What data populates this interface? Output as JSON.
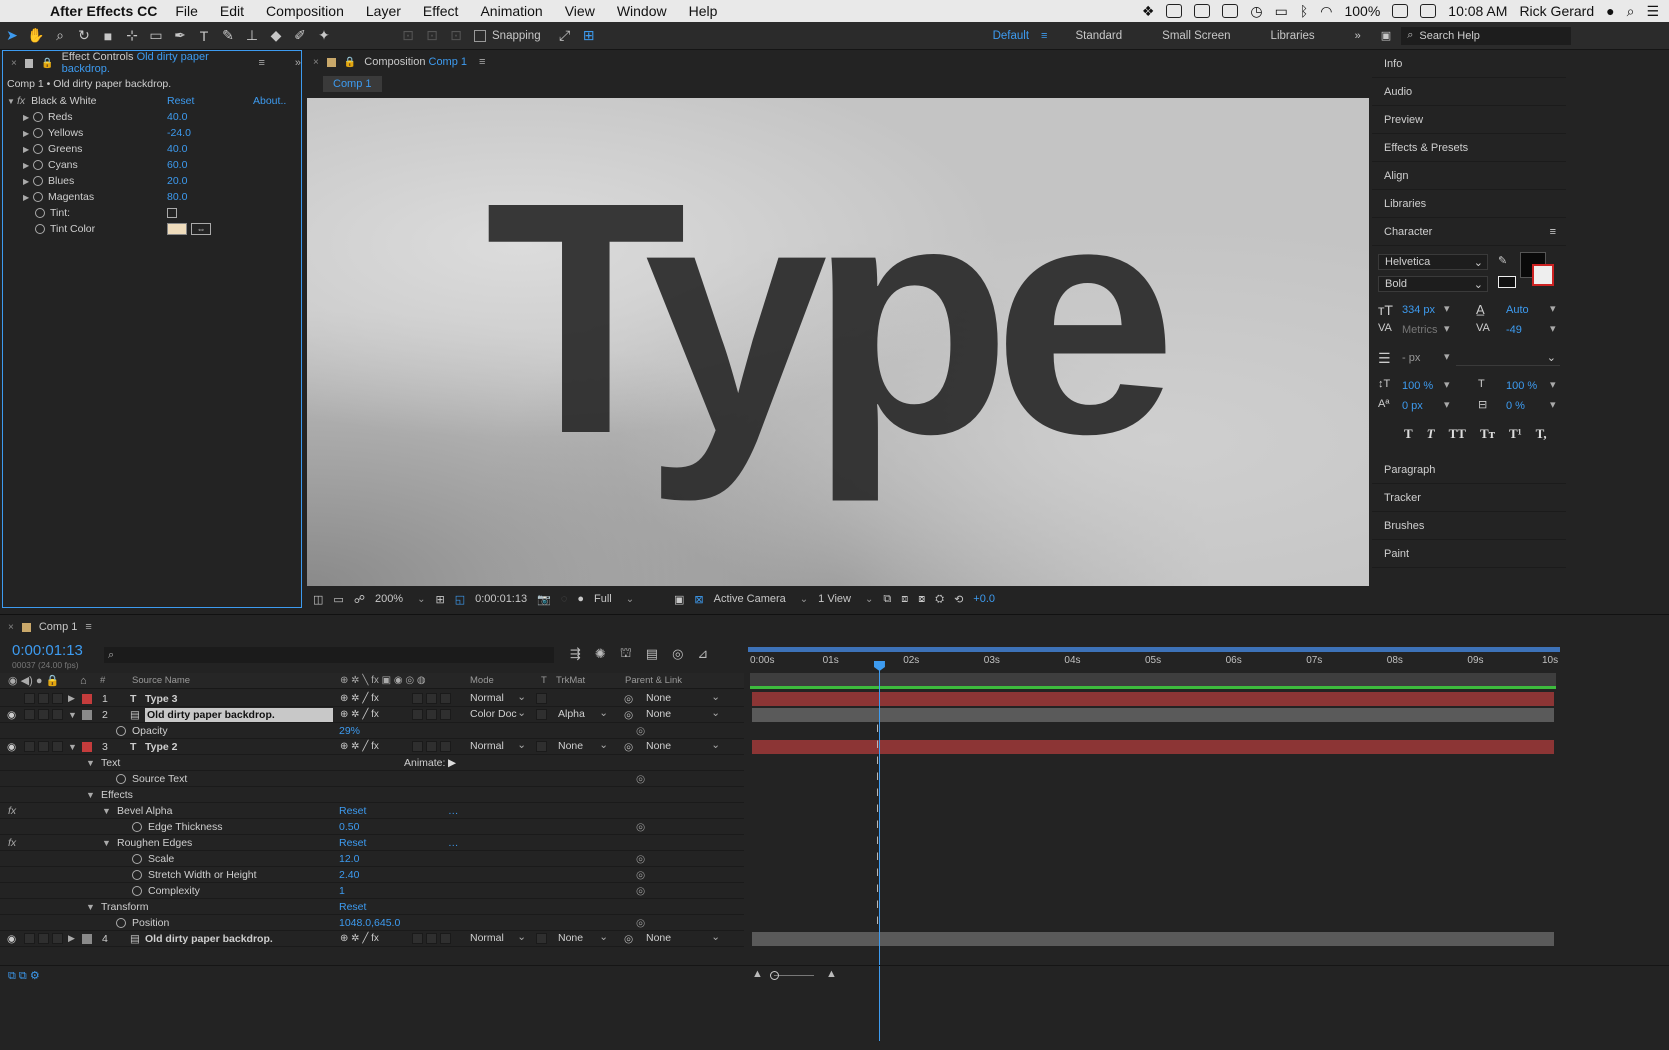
{
  "menubar": {
    "app_name": "After Effects CC",
    "items": [
      "File",
      "Edit",
      "Composition",
      "Layer",
      "Effect",
      "Animation",
      "View",
      "Window",
      "Help"
    ],
    "battery": "100%",
    "clock": "10:08 AM",
    "user": "Rick Gerard"
  },
  "toolbar": {
    "snapping_label": "Snapping",
    "workspaces": [
      "Default",
      "Standard",
      "Small Screen",
      "Libraries"
    ],
    "search_placeholder": "Search Help"
  },
  "effect_controls": {
    "tab_prefix": "Effect Controls",
    "tab_layer": "Old dirty paper backdrop.",
    "breadcrumb": "Comp 1 • Old dirty paper backdrop.",
    "effect_name": "Black & White",
    "reset_label": "Reset",
    "about_label": "About..",
    "params": [
      {
        "name": "Reds",
        "value": "40.0"
      },
      {
        "name": "Yellows",
        "value": "-24.0"
      },
      {
        "name": "Greens",
        "value": "40.0"
      },
      {
        "name": "Cyans",
        "value": "60.0"
      },
      {
        "name": "Blues",
        "value": "20.0"
      },
      {
        "name": "Magentas",
        "value": "80.0"
      }
    ],
    "tint_label": "Tint:",
    "tint_color_label": "Tint Color",
    "tint_color_hex": "#efdcbc"
  },
  "composition": {
    "tab_prefix": "Composition",
    "tab_name": "Comp 1",
    "flowchart_tab": "Comp 1",
    "canvas_text": "Type",
    "zoom": "200%",
    "timecode": "0:00:01:13",
    "resolution": "Full",
    "camera": "Active Camera",
    "views": "1 View",
    "exposure": "+0.0"
  },
  "right_panel": {
    "items_top": [
      "Info",
      "Audio",
      "Preview",
      "Effects & Presets",
      "Align",
      "Libraries"
    ],
    "character": {
      "title": "Character",
      "font": "Helvetica",
      "style": "Bold",
      "size": "334 px",
      "leading": "Auto",
      "kerning": "Metrics",
      "tracking": "-49",
      "stroke_width": "- px",
      "vert_scale": "100 %",
      "horiz_scale": "100 %",
      "baseline": "0 px",
      "tsume": "0 %",
      "style_buttons": [
        "T",
        "T",
        "TT",
        "Tт",
        "T¹",
        "T,"
      ]
    },
    "items_bottom": [
      "Paragraph",
      "Tracker",
      "Brushes",
      "Paint"
    ]
  },
  "timeline": {
    "tab_name": "Comp 1",
    "timecode": "0:00:01:13",
    "frame_info": "00037 (24.00 fps)",
    "columns": {
      "num": "#",
      "source": "Source Name",
      "mode": "Mode",
      "t": "T",
      "trkmat": "TrkMat",
      "parent": "Parent & Link"
    },
    "ruler": [
      "0:00s",
      "01s",
      "02s",
      "03s",
      "04s",
      "05s",
      "06s",
      "07s",
      "08s",
      "09s",
      "10s"
    ],
    "playhead_fraction": 0.16,
    "rows": [
      {
        "kind": "layer",
        "num": "1",
        "name": "Type 3",
        "mode": "Normal",
        "trkmat": "",
        "parent": "None",
        "label_color": "#c43c3c"
      },
      {
        "kind": "layer",
        "num": "2",
        "name": "Old dirty paper backdrop.",
        "mode": "Color Doc",
        "trkmat": "Alpha",
        "parent": "None",
        "label_color": "#8a8a8a"
      },
      {
        "kind": "prop",
        "name": "Opacity",
        "value": "29%"
      },
      {
        "kind": "layer",
        "num": "3",
        "name": "Type 2",
        "mode": "Normal",
        "trkmat": "None",
        "parent": "None",
        "label_color": "#c43c3c"
      },
      {
        "kind": "group",
        "name": "Text",
        "extra": "Animate:"
      },
      {
        "kind": "prop",
        "name": "Source Text",
        "value": ""
      },
      {
        "kind": "group",
        "name": "Effects",
        "extra": ""
      },
      {
        "kind": "effect",
        "name": "Bevel Alpha",
        "value": "Reset"
      },
      {
        "kind": "prop2",
        "name": "Edge Thickness",
        "value": "0.50"
      },
      {
        "kind": "effect",
        "name": "Roughen Edges",
        "value": "Reset"
      },
      {
        "kind": "prop2",
        "name": "Scale",
        "value": "12.0"
      },
      {
        "kind": "prop2",
        "name": "Stretch Width or Height",
        "value": "2.40"
      },
      {
        "kind": "prop2",
        "name": "Complexity",
        "value": "1"
      },
      {
        "kind": "group",
        "name": "Transform",
        "extra": "Reset"
      },
      {
        "kind": "prop",
        "name": "Position",
        "value": "1048.0,645.0"
      },
      {
        "kind": "layer",
        "num": "4",
        "name": "Old dirty paper backdrop.",
        "mode": "Normal",
        "trkmat": "None",
        "parent": "None",
        "label_color": "#8a8a8a"
      }
    ]
  },
  "colors": {
    "accent": "#3d9bf0",
    "red_bar": "#8c3535",
    "gray_bar": "#5a5a5a",
    "green_bar": "#3dbb3d"
  }
}
